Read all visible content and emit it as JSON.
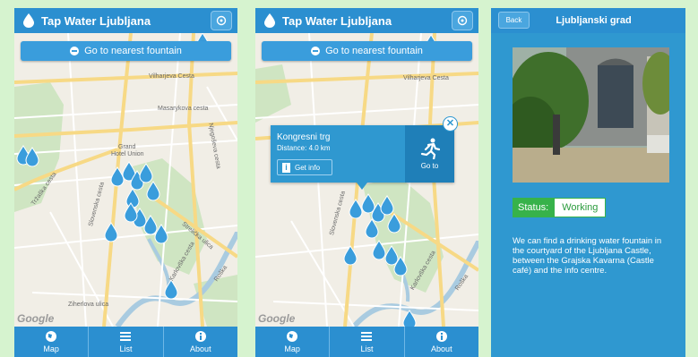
{
  "screen_map": {
    "title": "Tap Water Ljubljana",
    "nearest_button": "Go to nearest fountain",
    "labels": {
      "vilharjeva": "Vilharjeva Cesta",
      "masarykova": "Masarykova cesta",
      "grand": "Grand",
      "hotel_union": "Hotel Union",
      "slovenska": "Slovenska cesta",
      "trzaska": "Tržaška cesta",
      "karlovska": "Karlovška cesta",
      "ziherlova": "Ziherlova ulica",
      "roska": "Roška",
      "streliska": "Strelička ulica",
      "kopitarjeva": "Njegoševa cesta"
    },
    "google": "Google"
  },
  "screen_popup": {
    "title": "Tap Water Ljubljana",
    "nearest_button": "Go to nearest fountain",
    "popup": {
      "name": "Kongresni trg",
      "distance": "Distance: 4.0 km",
      "info_button": "Get info",
      "goto_label": "Go to",
      "close": "✕"
    },
    "labels": {
      "vilharjeva": "Vilharjeva Cesta",
      "slovenska": "Slovenska cesta",
      "karlovska": "Karlovška cesta",
      "roska": "Roška"
    },
    "google": "Google"
  },
  "tabs": [
    {
      "label": "Map",
      "icon": "globe-icon"
    },
    {
      "label": "List",
      "icon": "list-icon"
    },
    {
      "label": "About",
      "icon": "info-icon"
    }
  ],
  "detail": {
    "back": "Back",
    "title": "Ljubljanski grad",
    "status_label": "Status:",
    "status_value": "Working",
    "description": "We can find a drinking water fountain in the courtyard of the Ljubljana Castle, between the Grajska Kavarna (Castle café) and the info centre."
  },
  "colors": {
    "brand_blue": "#2b8fd0",
    "status_green": "#37b24a",
    "background": "#d6f3cf"
  }
}
